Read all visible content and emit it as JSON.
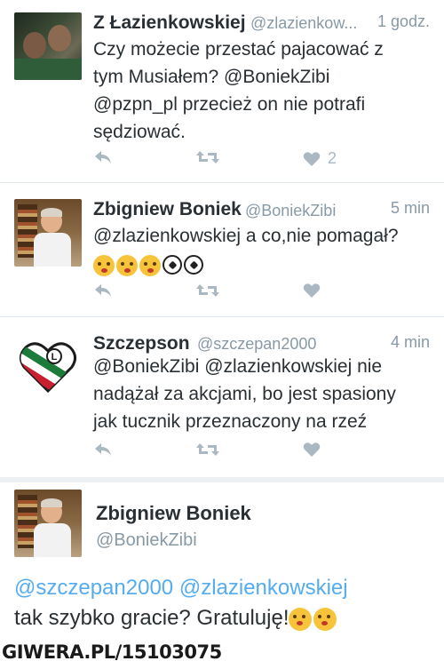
{
  "tweets": [
    {
      "name": "Z Łazienkowskiej",
      "handle": "@zlazienkow...",
      "time": "1 godz.",
      "text_lines": [
        "Czy możecie przestać pajacować z",
        "tym Musiałem? @BoniekZibi",
        "@pzpn_pl przecież on nie potrafi",
        "sędziować."
      ],
      "likes": "2"
    },
    {
      "name": "Zbigniew Boniek",
      "handle": "@BoniekZibi",
      "time": "5 min",
      "text_lines": [
        "@zlazienkowskiej a co,nie pomagał?"
      ],
      "emojis": [
        "kissing-face",
        "kissing-face",
        "kissing-face",
        "soccer-ball",
        "soccer-ball"
      ]
    },
    {
      "name": "Szczepson",
      "handle": "@szczepan2000",
      "time": "4 min",
      "text_lines": [
        "@BoniekZibi @zlazienkowskiej nie",
        "nadążał za akcjami, bo jest spasiony",
        "jak tucznik przeznaczony na rzeź"
      ]
    }
  ],
  "detail": {
    "name": "Zbigniew Boniek",
    "handle": "@BoniekZibi",
    "mention1": "@szczepan2000",
    "mention2": "@zlazienkowskiej",
    "text": "tak szybko gracie? Gratuluję!",
    "emojis": [
      "kissing-face",
      "kissing-face"
    ]
  },
  "watermark": "GIWERA.PL/15103075",
  "colors": {
    "link": "#55acee",
    "muted": "#8899a6",
    "icon": "#aab8c2",
    "text": "#292f33"
  },
  "icons": {
    "reply": "reply-icon",
    "retweet": "retweet-icon",
    "like": "heart-icon"
  }
}
